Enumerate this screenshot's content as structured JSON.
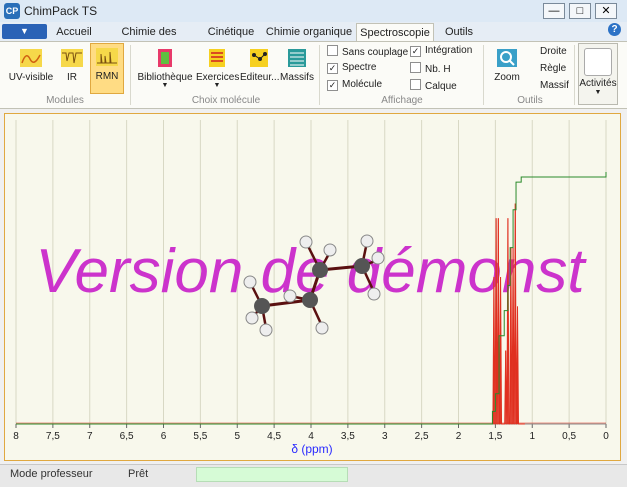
{
  "window": {
    "title": "ChimPack TS",
    "icon_label": "CP"
  },
  "tabs": [
    {
      "label": "Accueil"
    },
    {
      "label": "Chimie des solutions"
    },
    {
      "label": "Cinétique"
    },
    {
      "label": "Chimie organique"
    },
    {
      "label": "Spectroscopie"
    },
    {
      "label": "Outils"
    }
  ],
  "active_tab": "Spectroscopie",
  "ribbon": {
    "modules": {
      "label": "Modules",
      "buttons": [
        {
          "label": "UV-visible",
          "icon": "uv-visible-icon"
        },
        {
          "label": "IR",
          "icon": "ir-spectrum-icon"
        },
        {
          "label": "RMN",
          "icon": "nmr-spectrum-icon",
          "selected": true
        }
      ]
    },
    "choix_molecule": {
      "label": "Choix molécule",
      "buttons": [
        {
          "label": "Bibliothèque",
          "icon": "library-icon"
        },
        {
          "label": "Exercices",
          "icon": "exercises-icon"
        },
        {
          "label": "Editeur...",
          "icon": "editor-icon"
        },
        {
          "label": "Massifs",
          "icon": "multiplets-icon"
        }
      ]
    },
    "affichage": {
      "label": "Affichage",
      "options": [
        {
          "label": "Sans couplage",
          "checked": false
        },
        {
          "label": "Spectre",
          "checked": true
        },
        {
          "label": "Molécule",
          "checked": true
        },
        {
          "label": "Intégration",
          "checked": true
        },
        {
          "label": "Nb. H",
          "checked": false
        },
        {
          "label": "Calque",
          "checked": false
        }
      ]
    },
    "outils": {
      "label": "Outils",
      "zoom_label": "Zoom",
      "items": [
        "Droite",
        "Règle",
        "Massif"
      ]
    },
    "activites_label": "Activités"
  },
  "chart_data": {
    "type": "line",
    "title": "",
    "xlabel": "δ (ppm)",
    "xlim": [
      8,
      0
    ],
    "x_ticks": [
      "8",
      "7,5",
      "7",
      "6,5",
      "6",
      "5,5",
      "5",
      "4,5",
      "4",
      "3,5",
      "3",
      "2,5",
      "2",
      "1,5",
      "1",
      "0,5",
      "0"
    ],
    "grid": true,
    "series": [
      {
        "kind": "spectrum",
        "color": "#e03020",
        "peaks": [
          {
            "x": 1.52,
            "height": 0.5
          },
          {
            "x": 1.49,
            "height": 0.7
          },
          {
            "x": 1.46,
            "height": 0.7
          },
          {
            "x": 1.43,
            "height": 0.5
          },
          {
            "x": 1.36,
            "height": 0.25
          },
          {
            "x": 1.33,
            "height": 0.7
          },
          {
            "x": 1.29,
            "height": 0.6
          },
          {
            "x": 1.26,
            "height": 0.6
          },
          {
            "x": 1.23,
            "height": 0.75
          },
          {
            "x": 1.2,
            "height": 0.4
          }
        ]
      },
      {
        "kind": "integration",
        "color": "#2a8a2a",
        "steps": [
          {
            "x": 1.6,
            "value": 0.0
          },
          {
            "x": 1.54,
            "value": 0.05
          },
          {
            "x": 1.5,
            "value": 0.12
          },
          {
            "x": 1.45,
            "value": 0.35
          },
          {
            "x": 1.38,
            "value": 0.45
          },
          {
            "x": 1.33,
            "value": 0.55
          },
          {
            "x": 1.3,
            "value": 0.7
          },
          {
            "x": 1.26,
            "value": 0.85
          },
          {
            "x": 1.22,
            "value": 0.96
          },
          {
            "x": 1.15,
            "value": 0.98
          },
          {
            "x": 0.0,
            "value": 1.0
          }
        ]
      }
    ]
  },
  "watermark": "Version de démonst",
  "status": {
    "mode": "Mode professeur",
    "state": "Prêt"
  },
  "colors": {
    "accent": "#e0a840",
    "selected": "#ffdc84",
    "plot_bg": "#f8f8ec",
    "watermark": "#cc33cc"
  }
}
